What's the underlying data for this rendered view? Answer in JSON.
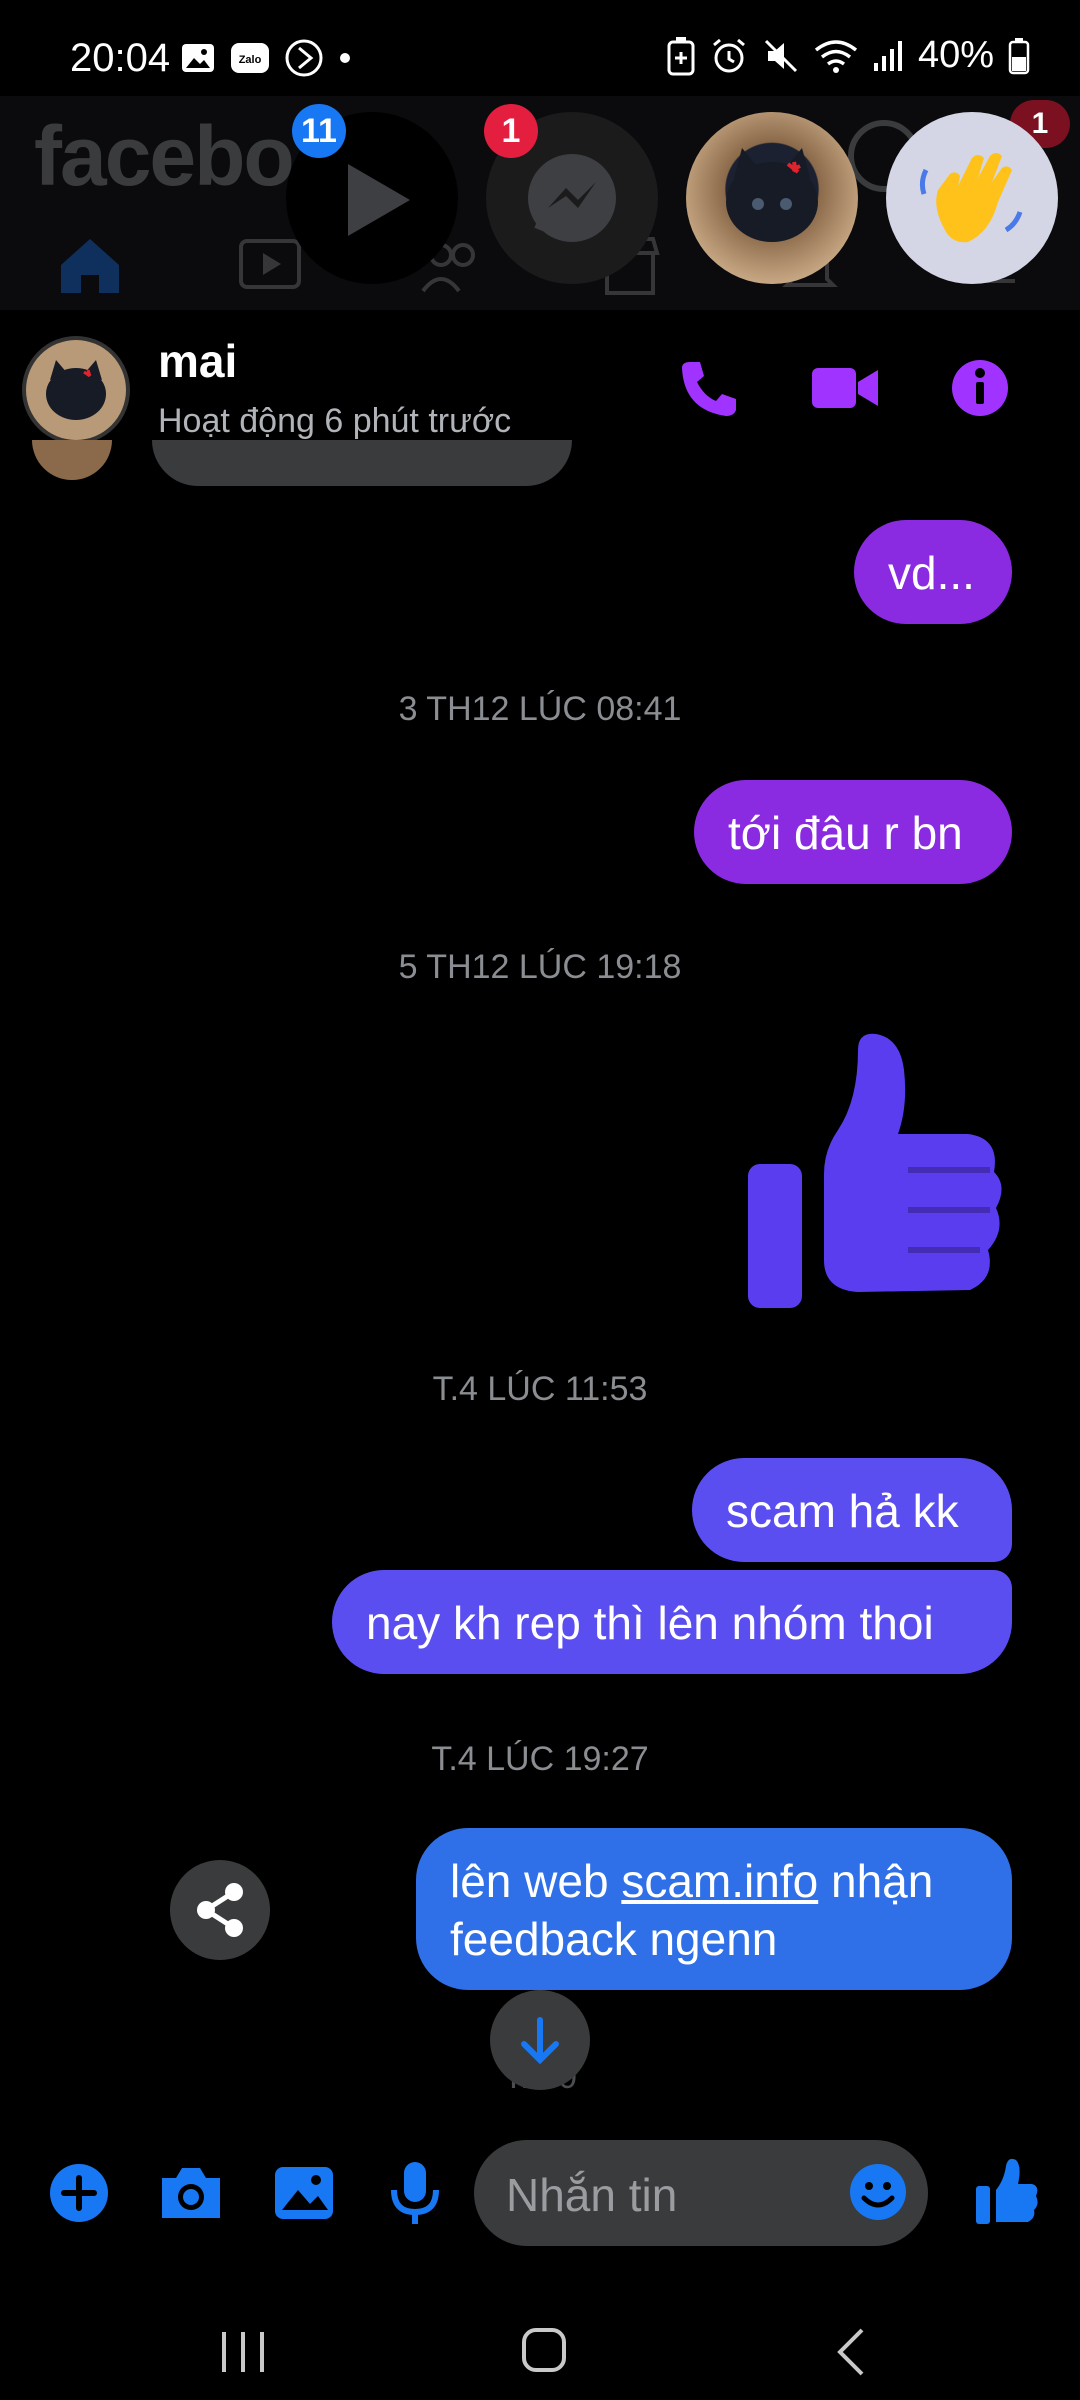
{
  "status_bar": {
    "time": "20:04",
    "battery": "40%",
    "icons": [
      "image-icon",
      "zalo-icon",
      "media-icon",
      "dot-icon",
      "battery-saver-icon",
      "alarm-icon",
      "mute-icon",
      "wifi-icon",
      "signal-icon",
      "battery-icon"
    ]
  },
  "background_app": {
    "logo": "facebo",
    "tabs": [
      "home-icon",
      "video-icon",
      "friends-icon",
      "marketplace-icon",
      "notifications-icon",
      "menu-icon"
    ],
    "notification_badge": "1"
  },
  "chat_heads": [
    {
      "name": "video",
      "badge": "11",
      "badge_color": "#1877f2"
    },
    {
      "name": "messenger",
      "badge": "1",
      "badge_color": "#e41e3f"
    },
    {
      "name": "mai-avatar"
    },
    {
      "name": "wave"
    }
  ],
  "conversation": {
    "contact_name": "mai",
    "contact_status": "Hoạt động 6 phút trước",
    "actions": [
      "phone-icon",
      "video-call-icon",
      "info-icon"
    ],
    "accent_color": "#a033ff"
  },
  "messages": {
    "msg1": "vd...",
    "ts1": "3 TH12 LÚC 08:41",
    "msg2": "tới đâu r bn",
    "ts2": "5 TH12 LÚC 19:18",
    "ts3": "T.4 LÚC 11:53",
    "msg3": "scam hả kk",
    "msg4": "nay kh rep thì lên nhóm thoi",
    "ts4": "T.4 LÚC 19:27",
    "msg5_prefix": "lên web ",
    "msg5_link": "scam.info",
    "msg5_suffix": " nhận",
    "msg5_line2": "feedback ngenn",
    "ts5_partial": "T.4 0"
  },
  "composer": {
    "placeholder": "Nhắn tin"
  },
  "colors": {
    "bubble_purple": "#8a2be2",
    "bubble_indigo": "#5b4ef0",
    "bubble_blue": "#2f6fe8",
    "icon_blue": "#1877f2"
  }
}
